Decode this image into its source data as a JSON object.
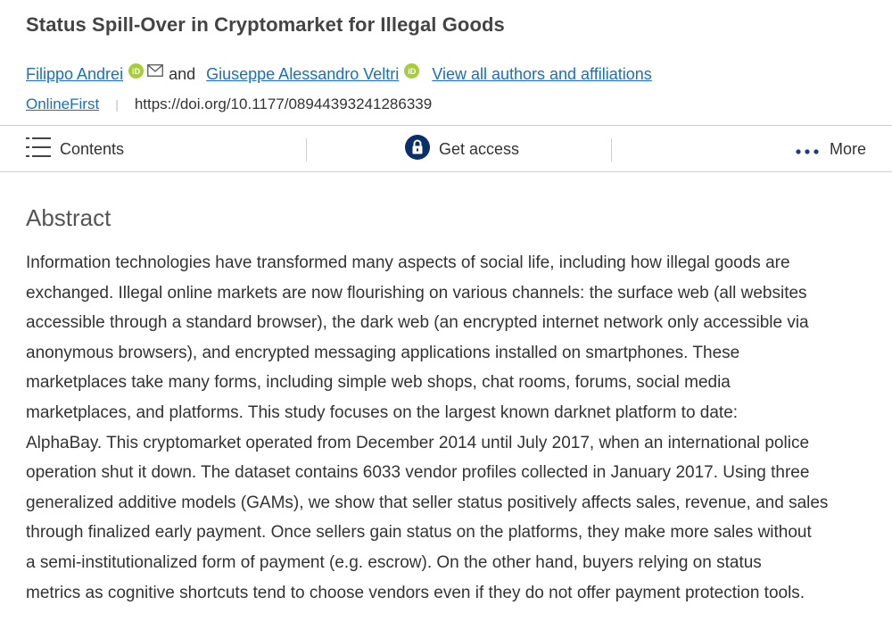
{
  "article": {
    "title": "Status Spill-Over in Cryptomarket for Illegal Goods",
    "authors": [
      {
        "name": "Filippo Andrei",
        "orcid_badge": "iD"
      },
      {
        "name": "Giuseppe Alessandro Veltri",
        "orcid_badge": "iD"
      }
    ],
    "and_text": "and",
    "view_all_label": "View all authors and affiliations",
    "status": "OnlineFirst",
    "separator": "|",
    "doi": "https://doi.org/10.1177/08944393241286339"
  },
  "toolbar": {
    "contents_label": "Contents",
    "get_access_label": "Get access",
    "more_label": "More"
  },
  "abstract": {
    "heading": "Abstract",
    "lines": [
      "Information technologies have transformed many aspects of social life, including how illegal goods are",
      "exchanged. Illegal online markets are now flourishing on various channels: the surface web (all websites",
      "accessible through a standard browser), the dark web (an encrypted internet network only accessible via",
      "anonymous browsers), and encrypted messaging applications installed on smartphones. These",
      "marketplaces take many forms, including simple web shops, chat rooms, forums, social media",
      "marketplaces, and platforms. This study focuses on the largest known darknet platform to date:",
      "AlphaBay. This cryptomarket operated from December 2014 until July 2017, when an international police",
      "operation shut it down. The dataset contains 6033 vendor profiles collected in January 2017. Using three",
      "generalized additive models (GAMs), we show that seller status positively affects sales, revenue, and sales",
      "through finalized early payment. Once sellers gain status on the platforms, they make more sales without",
      "a semi-institutionalized form of payment (e.g. escrow). On the other hand, buyers relying on status",
      "metrics as cognitive shortcuts tend to choose vendors even if they do not offer payment protection tools."
    ]
  },
  "colors": {
    "link": "#1a6fbf",
    "orcid": "#a6ce39",
    "lock_badge": "#0b2f6b",
    "more_dots": "#1b3a8a"
  }
}
